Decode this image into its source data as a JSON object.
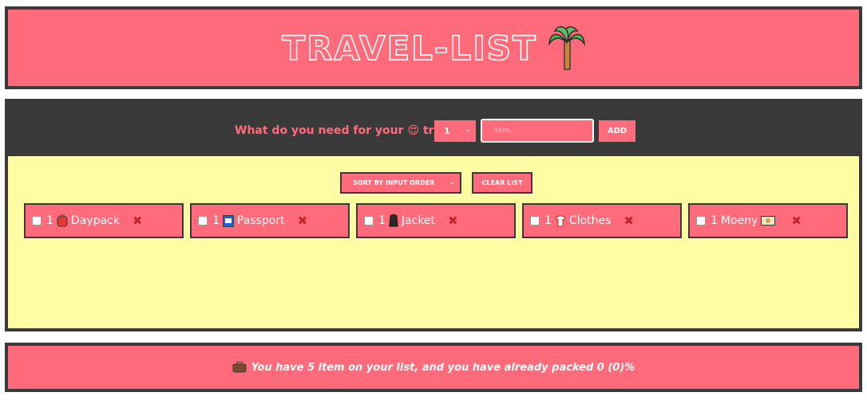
{
  "header": {
    "title": "TRAVEL-LIST",
    "icon": "palm-tree-icon"
  },
  "form": {
    "question_before": "What do you need for your",
    "question_emoji": "😍",
    "question_after": "trip",
    "quantity": "1",
    "item_placeholder": "Item...",
    "add_label": "ADD"
  },
  "actions": {
    "sort_label": "SORT BY INPUT ORDER",
    "clear_label": "CLEAR LIST"
  },
  "items": [
    {
      "quantity": "1",
      "name": "Daypack",
      "emoji": "daypack-icon",
      "packed": false
    },
    {
      "quantity": "1",
      "name": "Passport",
      "emoji": "passport-icon",
      "packed": false
    },
    {
      "quantity": "1",
      "name": "Jacket",
      "emoji": "jacket-icon",
      "packed": false
    },
    {
      "quantity": "1",
      "name": "Clothes",
      "emoji": "clothes-icon",
      "packed": false
    },
    {
      "quantity": "1",
      "name": "Moeny",
      "emoji": "money-icon",
      "packed": false
    }
  ],
  "stats": {
    "text": "You have 5 item on your list, and you have already packed 0 (0)%"
  },
  "colors": {
    "accent": "#ff6b7a",
    "dark": "#3a3a3a",
    "list_bg": "#fffca3",
    "delete": "#c0282d"
  }
}
